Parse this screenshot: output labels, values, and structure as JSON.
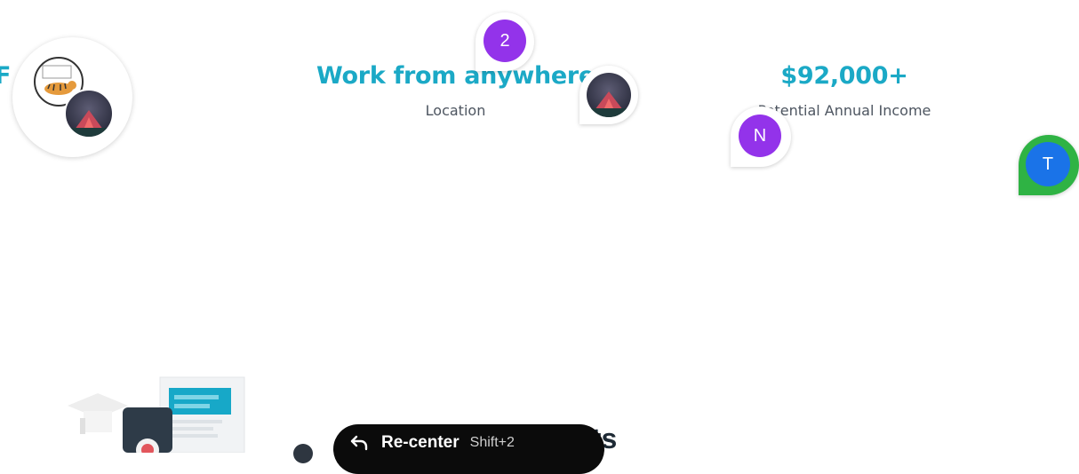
{
  "stats": [
    {
      "value": "F",
      "label": ""
    },
    {
      "value": "Work from anywhere",
      "label": "Location"
    },
    {
      "value": "$92,000+",
      "label": "Potential Annual Income"
    }
  ],
  "cursors": {
    "count_badge": "2",
    "user_n": "N",
    "user_t": "T"
  },
  "toolbar": {
    "recenter_label": "Re-center",
    "recenter_shortcut": "Shift+2"
  },
  "section": {
    "heading": "ments"
  },
  "colors": {
    "accent": "#1ba9c6",
    "cursor_purple": "#9333ea",
    "cursor_blue": "#1a73e8",
    "cursor_green": "#2fb344"
  }
}
